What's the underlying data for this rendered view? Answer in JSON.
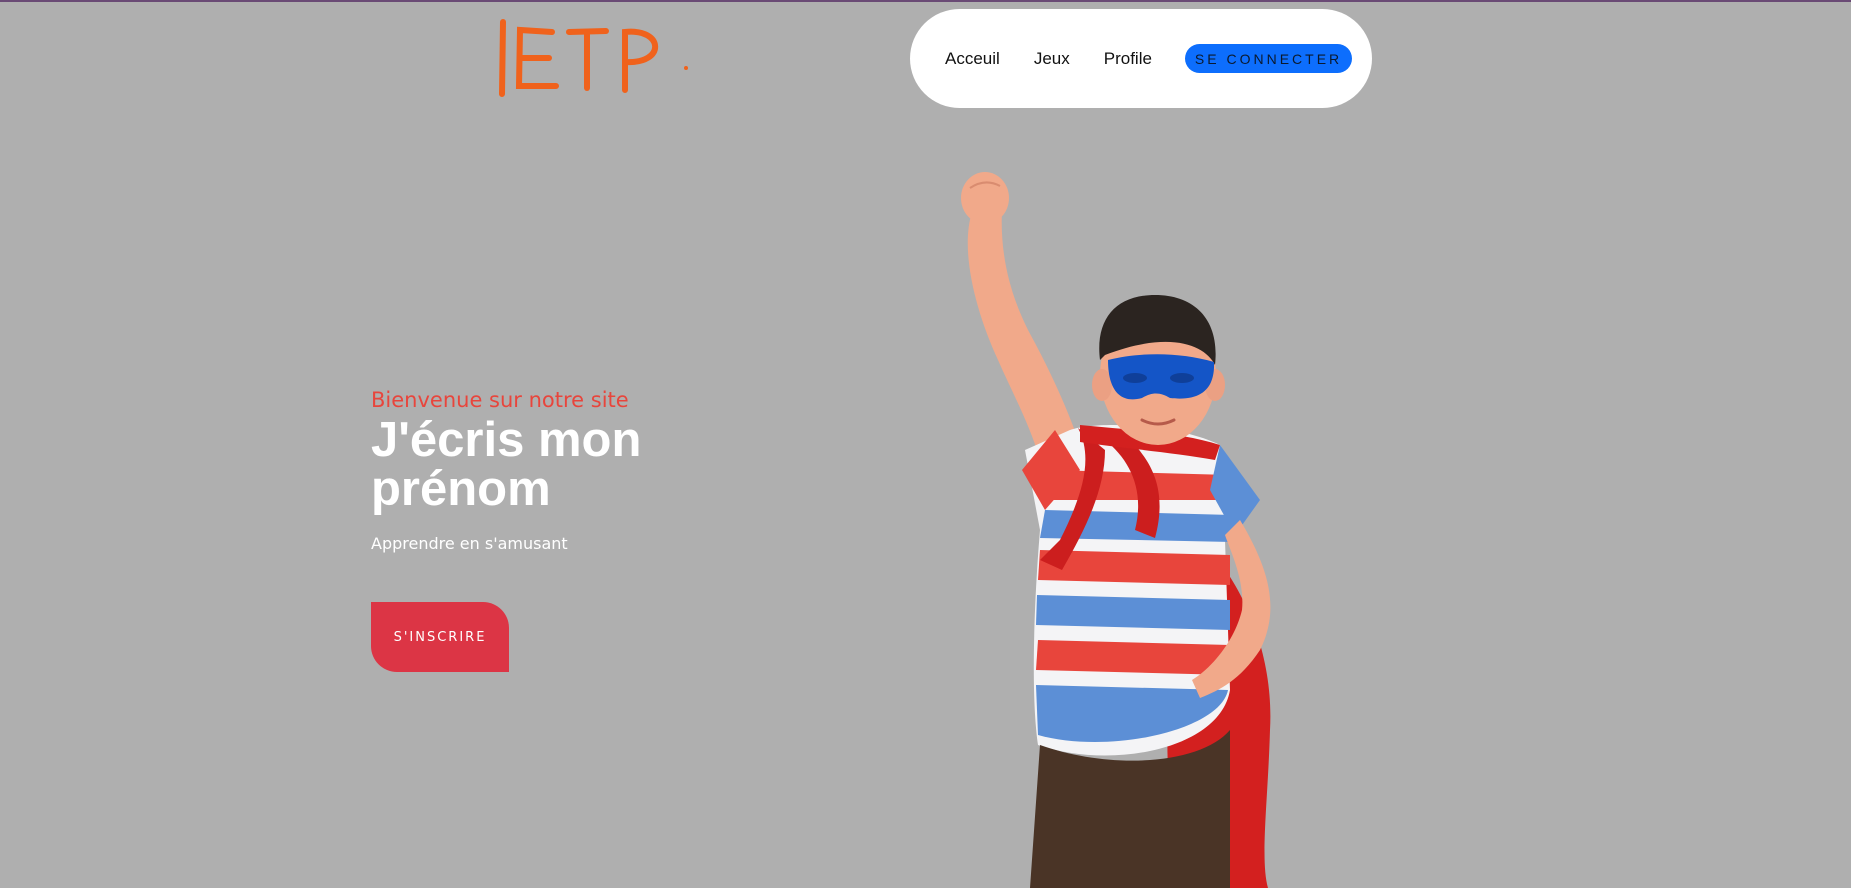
{
  "logo": {
    "text": "ETP",
    "color": "#f0621c"
  },
  "nav": {
    "links": [
      "Acceuil",
      "Jeux",
      "Profile"
    ],
    "login_label": "SE CONNECTER"
  },
  "hero": {
    "subtitle": "Bienvenue sur notre site",
    "title": "J'écris mon prénom",
    "tagline": "Apprendre en s'amusant",
    "cta_label": "S'INSCRIRE"
  },
  "colors": {
    "background": "#afafaf",
    "accent_red": "#dc3545",
    "primary_blue": "#0d6efd",
    "logo_orange": "#f0621c"
  }
}
